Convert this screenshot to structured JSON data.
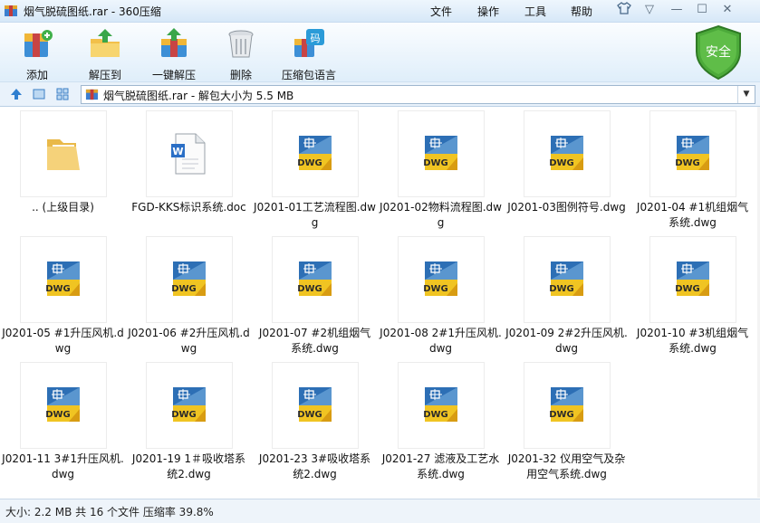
{
  "window": {
    "title": "烟气脱硫图纸.rar - 360压缩"
  },
  "menu": [
    "文件",
    "操作",
    "工具",
    "帮助"
  ],
  "toolbar": [
    {
      "label": "添加",
      "icon": "add-archive-icon"
    },
    {
      "label": "解压到",
      "icon": "extract-to-icon"
    },
    {
      "label": "一键解压",
      "icon": "one-click-extract-icon"
    },
    {
      "label": "删除",
      "icon": "trash-icon"
    },
    {
      "label": "压缩包语言",
      "icon": "archive-language-icon",
      "badge": "码"
    }
  ],
  "security": {
    "label": "安全"
  },
  "address": {
    "text": "烟气脱硫图纸.rar - 解包大小为 5.5 MB"
  },
  "files": [
    {
      "name": ".. (上级目录)",
      "type": "folder"
    },
    {
      "name": "FGD-KKS标识系统.doc",
      "type": "doc"
    },
    {
      "name": "J0201-01工艺流程图.dwg",
      "type": "dwg"
    },
    {
      "name": "J0201-02物料流程图.dwg",
      "type": "dwg"
    },
    {
      "name": "J0201-03图例符号.dwg",
      "type": "dwg"
    },
    {
      "name": "J0201-04 #1机组烟气系统.dwg",
      "type": "dwg"
    },
    {
      "name": "J0201-05 #1升压风机.dwg",
      "type": "dwg"
    },
    {
      "name": "J0201-06 #2升压风机.dwg",
      "type": "dwg"
    },
    {
      "name": "J0201-07 #2机组烟气系统.dwg",
      "type": "dwg"
    },
    {
      "name": "J0201-08 2#1升压风机.dwg",
      "type": "dwg"
    },
    {
      "name": "J0201-09 2#2升压风机.dwg",
      "type": "dwg"
    },
    {
      "name": "J0201-10 #3机组烟气系统.dwg",
      "type": "dwg"
    },
    {
      "name": "J0201-11 3#1升压风机.dwg",
      "type": "dwg"
    },
    {
      "name": "J0201-19 1＃吸收塔系统2.dwg",
      "type": "dwg"
    },
    {
      "name": "J0201-23 3#吸收塔系统2.dwg",
      "type": "dwg"
    },
    {
      "name": "J0201-27 滤液及工艺水系统.dwg",
      "type": "dwg"
    },
    {
      "name": "J0201-32 仪用空气及杂用空气系统.dwg",
      "type": "dwg"
    }
  ],
  "dwg_label": "DWG",
  "doc_label": "W",
  "status": {
    "text": "大小: 2.2 MB 共 16 个文件 压缩率 39.8%"
  }
}
